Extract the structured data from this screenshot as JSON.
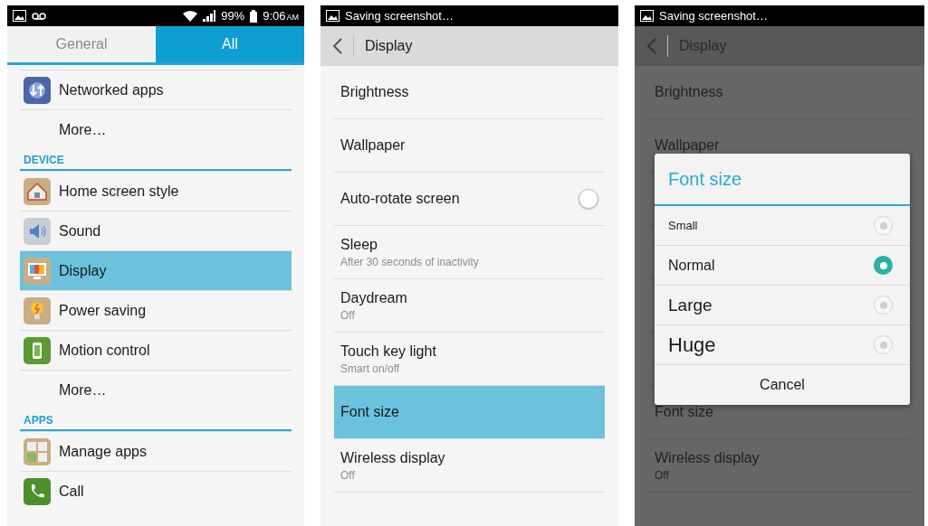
{
  "screens": [
    {
      "status_bar": {
        "kind": "full",
        "battery": "99%",
        "time": "9:06",
        "meridiem": "AM"
      },
      "tabs": [
        {
          "label": "General",
          "selected": false
        },
        {
          "label": "All",
          "selected": true
        }
      ],
      "list": [
        {
          "kind": "item",
          "label": "Networked apps",
          "selected": false
        },
        {
          "kind": "more",
          "label": "More…",
          "selected": false
        },
        {
          "kind": "header",
          "label": "DEVICE"
        },
        {
          "kind": "item",
          "label": "Home screen style",
          "selected": false
        },
        {
          "kind": "item",
          "label": "Sound",
          "selected": false
        },
        {
          "kind": "item",
          "label": "Display",
          "selected": true
        },
        {
          "kind": "item",
          "label": "Power saving",
          "selected": false
        },
        {
          "kind": "item",
          "label": "Motion control",
          "selected": false
        },
        {
          "kind": "more",
          "label": "More…",
          "selected": false
        },
        {
          "kind": "header",
          "label": "APPS"
        },
        {
          "kind": "item",
          "label": "Manage apps",
          "selected": false
        },
        {
          "kind": "item",
          "label": "Call",
          "selected": false
        }
      ]
    },
    {
      "status_bar": {
        "kind": "notice",
        "text": "Saving screenshot…"
      },
      "header": {
        "title": "Display"
      },
      "rows": [
        {
          "kind": "plain",
          "title": "Brightness",
          "selected": false
        },
        {
          "kind": "plain",
          "title": "Wallpaper",
          "selected": false
        },
        {
          "kind": "switch",
          "title": "Auto-rotate screen",
          "on": false,
          "selected": false
        },
        {
          "kind": "plain",
          "title": "Sleep",
          "subtitle": "After 30 seconds of inactivity",
          "selected": false
        },
        {
          "kind": "plain",
          "title": "Daydream",
          "subtitle": "Off",
          "selected": false
        },
        {
          "kind": "plain",
          "title": "Touch key light",
          "subtitle": "Smart on/off",
          "selected": false
        },
        {
          "kind": "plain",
          "title": "Font size",
          "selected": true
        },
        {
          "kind": "plain",
          "title": "Wireless display",
          "subtitle": "Off",
          "selected": false
        }
      ]
    },
    {
      "status_bar": {
        "kind": "notice",
        "text": "Saving screenshot…"
      },
      "header": {
        "title": "Display"
      },
      "rows": [
        {
          "kind": "plain",
          "title": "Brightness"
        },
        {
          "kind": "plain",
          "title": "Wallpaper"
        },
        {
          "kind": "covered"
        },
        {
          "kind": "covered"
        },
        {
          "kind": "covered"
        },
        {
          "kind": "covered"
        },
        {
          "kind": "plain",
          "title": "Font size"
        },
        {
          "kind": "plain",
          "title": "Wireless display",
          "subtitle": "Off"
        }
      ],
      "dialog": {
        "title": "Font size",
        "options": [
          {
            "label": "Small",
            "selected": false
          },
          {
            "label": "Normal",
            "selected": true
          },
          {
            "label": "Large",
            "selected": false
          },
          {
            "label": "Huge",
            "selected": false
          }
        ],
        "button": "Cancel"
      }
    }
  ]
}
